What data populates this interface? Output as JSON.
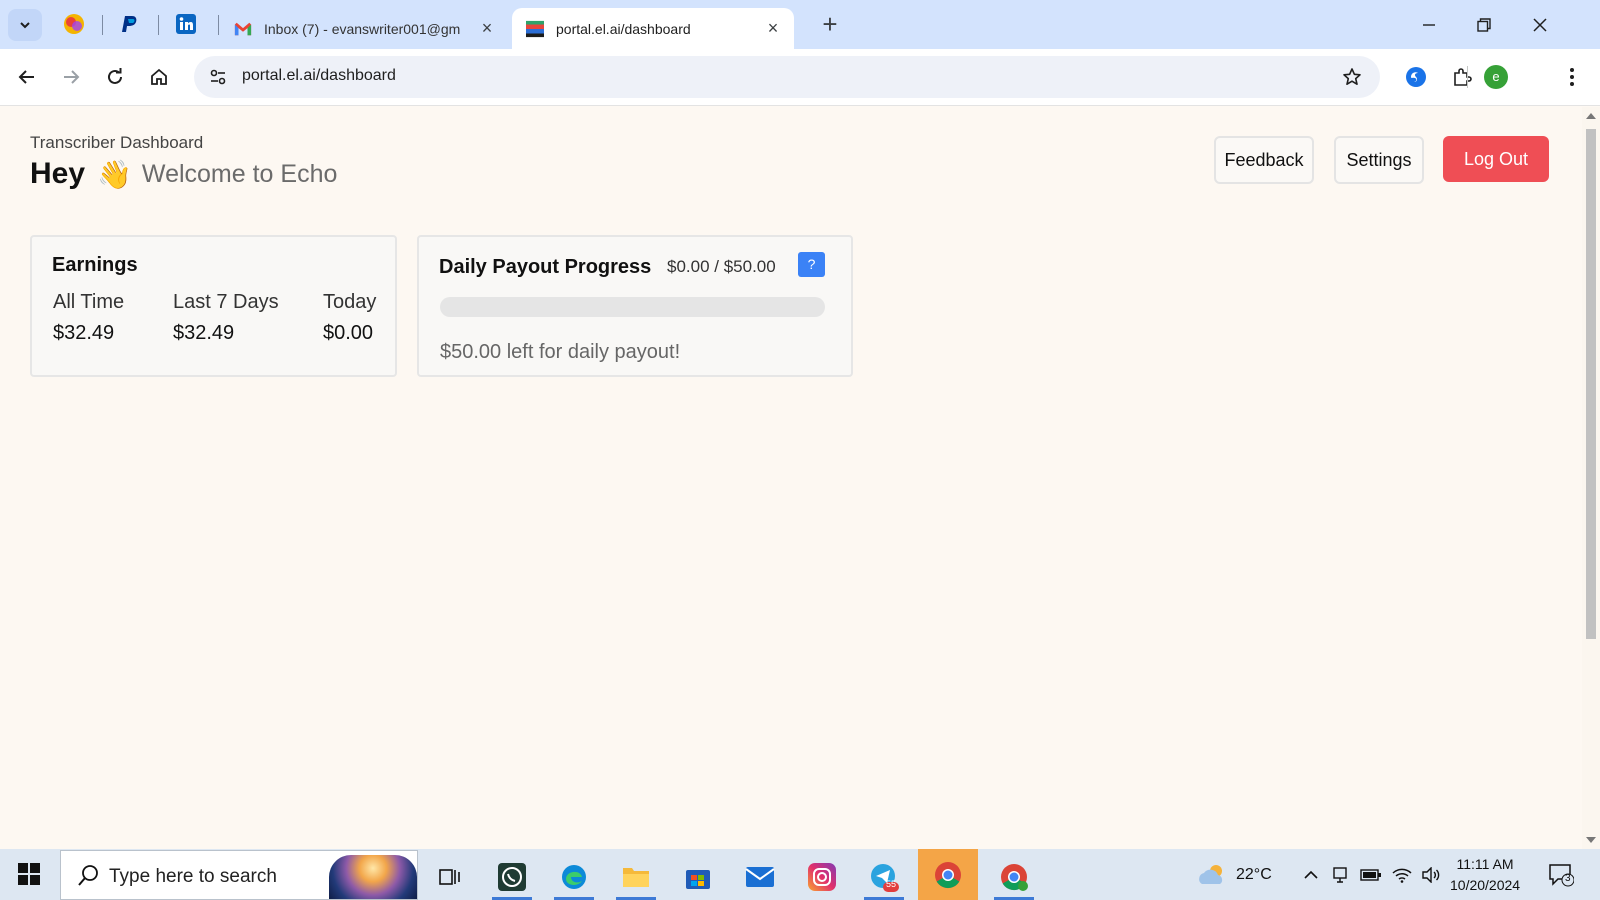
{
  "browser": {
    "tabs": [
      {
        "title": "Inbox (7) - evanswriter001@gm",
        "active": false
      },
      {
        "title": "portal.el.ai/dashboard",
        "active": true
      }
    ],
    "url": "portal.el.ai/dashboard",
    "profile_initial": "e"
  },
  "header": {
    "subtitle": "Transcriber Dashboard",
    "greeting": "Hey",
    "wave_emoji": "👋",
    "welcome": "Welcome to Echo",
    "feedback_label": "Feedback",
    "settings_label": "Settings",
    "logout_label": "Log Out"
  },
  "earnings": {
    "title": "Earnings",
    "columns": [
      {
        "label": "All Time",
        "value": "$32.49"
      },
      {
        "label": "Last 7 Days",
        "value": "$32.49"
      },
      {
        "label": "Today",
        "value": "$0.00"
      }
    ]
  },
  "payout": {
    "title": "Daily Payout Progress",
    "amount": "$0.00 / $50.00",
    "help": "?",
    "progress_fraction": 0,
    "remaining_text": "$50.00 left for daily payout!"
  },
  "taskbar": {
    "search_placeholder": "Type here to search",
    "weather": "22°C",
    "time": "11:11 AM",
    "date": "10/20/2024",
    "telegram_badge": "55",
    "notification_count": "3"
  },
  "colors": {
    "accent": "#3b82f6",
    "logout": "#ef4e55",
    "page_bg": "#fdf8f2"
  }
}
